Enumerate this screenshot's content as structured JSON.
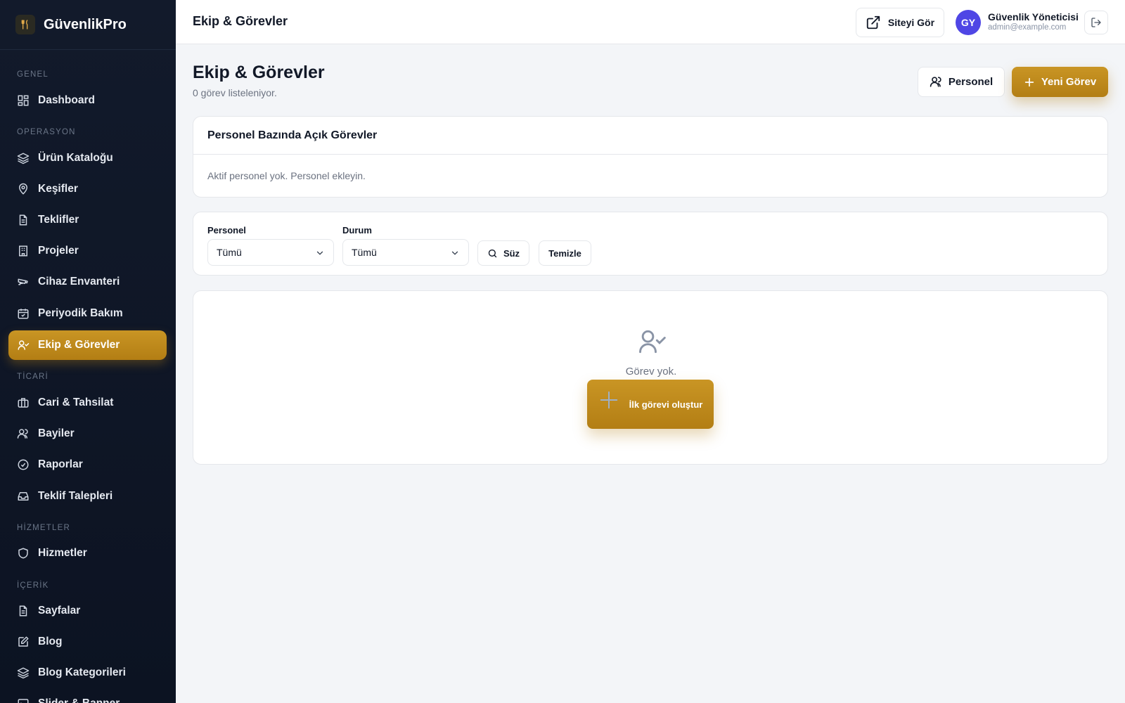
{
  "brand": {
    "name": "GüvenlikPro"
  },
  "sidebar": {
    "sections": {
      "genel": "GENEL",
      "operasyon": "OPERASYON",
      "ticari": "TİCARİ",
      "hizmetler": "HİZMETLER",
      "icerik": "İÇERİK"
    },
    "items": {
      "dashboard": "Dashboard",
      "urun": "Ürün Kataloğu",
      "kesifler": "Keşifler",
      "teklifler": "Teklifler",
      "projeler": "Projeler",
      "cihaz": "Cihaz Envanteri",
      "bakim": "Periyodik Bakım",
      "ekip": "Ekip & Görevler",
      "cari": "Cari & Tahsilat",
      "bayiler": "Bayiler",
      "raporlar": "Raporlar",
      "talepler": "Teklif Talepleri",
      "hizmetler": "Hizmetler",
      "sayfalar": "Sayfalar",
      "blog": "Blog",
      "blog_kat": "Blog Kategorileri",
      "slider": "Slider & Banner"
    },
    "active": "ekip"
  },
  "header": {
    "title": "Ekip & Görevler",
    "site_button": "Siteyi Gör",
    "user_initials": "GY",
    "user_name": "Güvenlik Yöneticisi",
    "user_email": "admin@example.com"
  },
  "main": {
    "title": "Ekip & Görevler",
    "subtitle": "0 görev listeleniyor.",
    "personel_button": "Personel",
    "new_button": "Yeni Görev",
    "open_tasks_card": {
      "title": "Personel Bazında Açık Görevler",
      "empty": "Aktif personel yok. Personel ekleyin."
    },
    "filters": {
      "personel_label": "Personel",
      "personel_value": "Tümü",
      "durum_label": "Durum",
      "durum_value": "Tümü",
      "filter_button": "Süz",
      "clear_button": "Temizle"
    },
    "empty_state": {
      "text": "Görev yok.",
      "button": "İlk görevi oluştur"
    }
  },
  "colors": {
    "accent": "#c08a1c",
    "sidebar_bg": "#0f1626",
    "avatar": "#4f46e5"
  }
}
